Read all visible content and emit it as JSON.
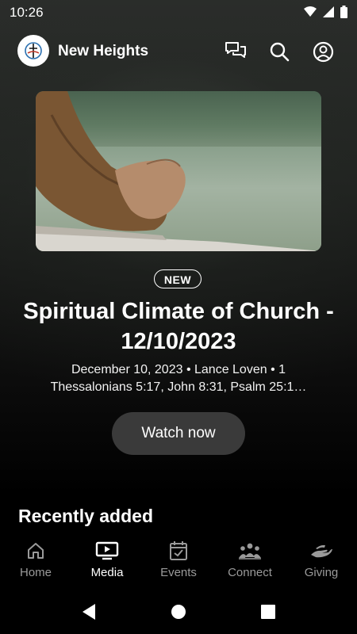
{
  "status_bar": {
    "time": "10:26"
  },
  "header": {
    "app_title": "New Heights"
  },
  "featured": {
    "badge": "NEW",
    "title": "Spiritual Climate of Church - 12/10/2023",
    "meta_line1": "December 10, 2023 • Lance Loven • 1",
    "meta_line2": "Thessalonians 5:17, John 8:31, Psalm 25:1…",
    "watch_label": "Watch now"
  },
  "section": {
    "recently_added": "Recently added"
  },
  "bottom_nav": {
    "items": [
      {
        "label": "Home",
        "icon": "home-icon",
        "active": false
      },
      {
        "label": "Media",
        "icon": "media-icon",
        "active": true
      },
      {
        "label": "Events",
        "icon": "calendar-icon",
        "active": false
      },
      {
        "label": "Connect",
        "icon": "people-icon",
        "active": false
      },
      {
        "label": "Giving",
        "icon": "giving-hand-icon",
        "active": false
      }
    ]
  },
  "colors": {
    "accent": "#ffffff",
    "inactive": "#9a9a9a",
    "button_bg": "#3a3a3a"
  }
}
